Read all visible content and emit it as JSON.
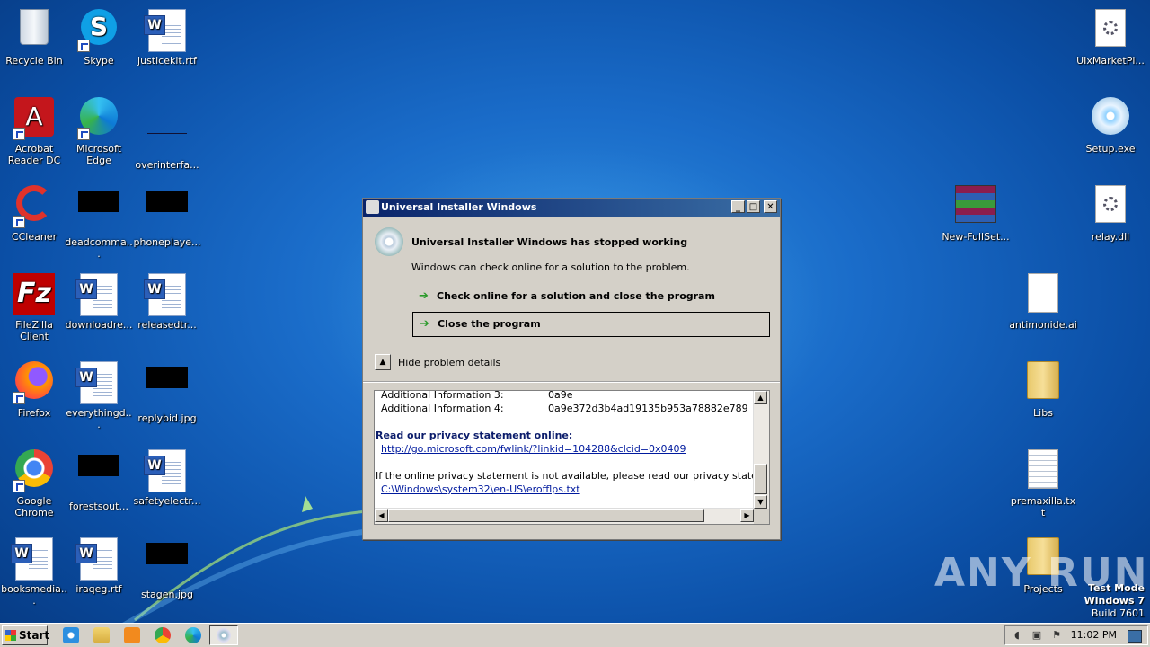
{
  "desktop": {
    "icons": [
      {
        "label": "Recycle Bin",
        "icon": "recycle-bin-icon"
      },
      {
        "label": "Skype",
        "icon": "skype-icon"
      },
      {
        "label": "justicekit.rtf",
        "icon": "word-document-icon"
      },
      {
        "label": "UIxMarketPl...",
        "icon": "dll-file-icon"
      },
      {
        "label": "Acrobat Reader DC",
        "icon": "acrobat-icon"
      },
      {
        "label": "Microsoft Edge",
        "icon": "edge-icon"
      },
      {
        "label": "overinterfa...",
        "icon": "file-icon"
      },
      {
        "label": "Setup.exe",
        "icon": "setup-disc-icon"
      },
      {
        "label": "CCleaner",
        "icon": "ccleaner-icon"
      },
      {
        "label": "deadcomma...",
        "icon": "black-thumbnail-icon"
      },
      {
        "label": "phoneplaye...",
        "icon": "black-thumbnail-icon"
      },
      {
        "label": "New-FullSet...",
        "icon": "winrar-icon"
      },
      {
        "label": "relay.dll",
        "icon": "dll-file-icon"
      },
      {
        "label": "FileZilla Client",
        "icon": "filezilla-icon"
      },
      {
        "label": "downloadre...",
        "icon": "word-document-icon"
      },
      {
        "label": "releasedtr...",
        "icon": "word-document-icon"
      },
      {
        "label": "antimonide.ai",
        "icon": "blank-file-icon"
      },
      {
        "label": "Firefox",
        "icon": "firefox-icon"
      },
      {
        "label": "everythingd...",
        "icon": "word-document-icon"
      },
      {
        "label": "replybid.jpg",
        "icon": "black-thumbnail-icon"
      },
      {
        "label": "Libs",
        "icon": "folder-icon"
      },
      {
        "label": "Google Chrome",
        "icon": "chrome-icon"
      },
      {
        "label": "forestsout...",
        "icon": "black-thumbnail-icon"
      },
      {
        "label": "safetyelectr...",
        "icon": "word-document-icon"
      },
      {
        "label": "premaxilla.txt",
        "icon": "text-file-icon"
      },
      {
        "label": "booksmedia...",
        "icon": "word-document-icon"
      },
      {
        "label": "iraqeg.rtf",
        "icon": "word-document-icon"
      },
      {
        "label": "stagen.jpg",
        "icon": "black-thumbnail-icon"
      },
      {
        "label": "Projects",
        "icon": "folder-icon"
      }
    ]
  },
  "dialog": {
    "window_title": "Universal Installer Windows",
    "minimize": "_",
    "maximize": "□",
    "close": "✕",
    "heading": "Universal Installer Windows has stopped working",
    "subtext": "Windows can check online for a solution to the problem.",
    "action_check_online": "Check online for a solution and close the program",
    "action_close": "Close the program",
    "hide_details": "Hide problem details",
    "details": {
      "add_info_3_label": "Additional Information 3:",
      "add_info_3_value": "0a9e",
      "add_info_4_label": "Additional Information 4:",
      "add_info_4_value": "0a9e372d3b4ad19135b953a78882e789",
      "privacy_heading": "Read our privacy statement online:",
      "privacy_link": "http://go.microsoft.com/fwlink/?linkid=104288&clcid=0x0409",
      "offline_text": "If the online privacy statement is not available, please read our privacy statement",
      "offline_path": "C:\\Windows\\system32\\en-US\\erofflps.txt"
    }
  },
  "watermark": "ANY RUN",
  "test_mode": {
    "line1": "Test Mode",
    "line2": "Windows 7",
    "line3": "Build 7601"
  },
  "taskbar": {
    "start_label": "Start",
    "clock": "11:02 PM",
    "quick_launch": [
      "internet-explorer-icon",
      "folder-icon",
      "media-player-icon",
      "chrome-icon",
      "edge-icon"
    ],
    "tray_icons": [
      "volume-icon",
      "network-icon",
      "flag-icon"
    ]
  }
}
